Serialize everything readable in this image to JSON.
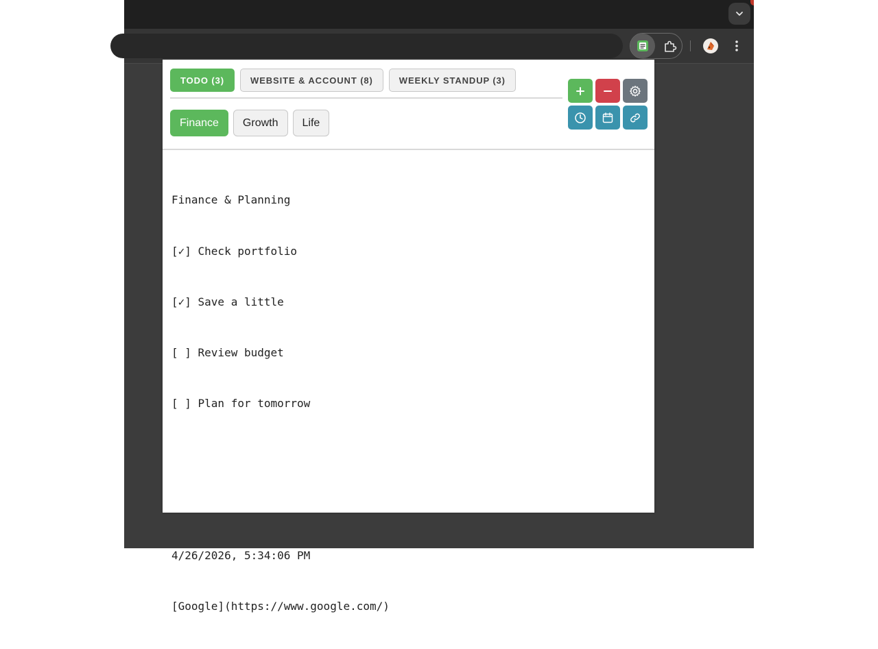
{
  "browser": {
    "colors": {
      "frame": "#1f1f1f",
      "toolbar": "#353535",
      "page": "#3c3c3c"
    }
  },
  "popup": {
    "tabs": [
      {
        "label": "TODO (3)",
        "active": true
      },
      {
        "label": "WEBSITE & ACCOUNT (8)",
        "active": false
      },
      {
        "label": "WEEKLY STANDUP (3)",
        "active": false
      }
    ],
    "subtabs": [
      {
        "label": "Finance",
        "active": true
      },
      {
        "label": "Growth",
        "active": false
      },
      {
        "label": "Life",
        "active": false
      }
    ],
    "actions": {
      "add_label": "+",
      "remove_label": "−",
      "icons": [
        "plus-icon",
        "minus-icon",
        "gear-icon",
        "clock-icon",
        "calendar-icon",
        "link-icon"
      ]
    },
    "note_lines": [
      "Finance & Planning",
      "[✓] Check portfolio",
      "[✓] Save a little",
      "[ ] Review budget",
      "[ ] Plan for tomorrow",
      "",
      "",
      "4/26/2026, 5:34:06 PM",
      "[Google](https://www.google.com/)"
    ],
    "colors": {
      "accent_green": "#5cb85c",
      "danger_red": "#d1414b",
      "neutral_gray": "#6c757d",
      "teal": "#3a93ad"
    }
  }
}
